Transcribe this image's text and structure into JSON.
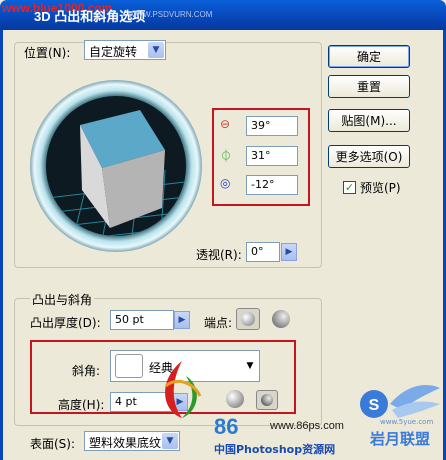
{
  "window": {
    "title": "3D 凸出和斜角选项",
    "watermark_site": "www.blue1000.com",
    "watermark_site2": "WWW.PSDVURN.COM"
  },
  "position": {
    "label": "位置(N):",
    "value": "自定旋转",
    "rotate_x": "39°",
    "rotate_y": "31°",
    "rotate_z": "-12°",
    "perspective_label": "透视(R):",
    "perspective_value": "0°"
  },
  "buttons": {
    "ok": "确定",
    "reset": "重置",
    "map": "贴图(M)...",
    "more_options": "更多选项(O)",
    "preview": "预览(P)"
  },
  "extrude": {
    "group_label": "凸出与斜角",
    "depth_label": "凸出厚度(D):",
    "depth_value": "50 pt",
    "cap_label": "端点:",
    "bevel_label": "斜角:",
    "bevel_value": "经典",
    "height_label": "高度(H):",
    "height_value": "4 pt"
  },
  "surface": {
    "label": "表面(S):",
    "value": "塑料效果底纹"
  },
  "watermarks": {
    "logo_86": "86",
    "site_86ps": "www.86ps.com",
    "site_86ps_cn": "中国Photoshop资源网",
    "bottom_right": "岩月联盟",
    "bottom_right_sub": "www.5yue.com"
  },
  "colors": {
    "title_blue": "#0846b8",
    "highlight_red": "#c4151c",
    "cube_top": "#5ba8c8",
    "cube_left": "#d9d9d9",
    "cube_right": "#b4b4b4"
  },
  "preview_checked": true
}
